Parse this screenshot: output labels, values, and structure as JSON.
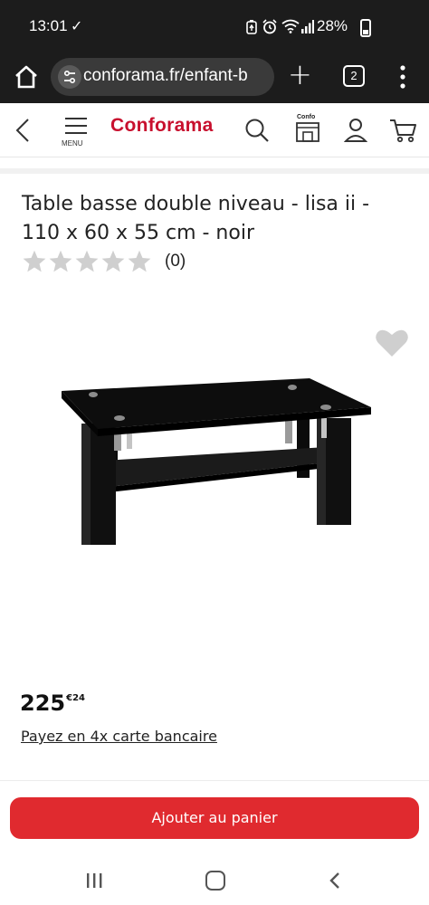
{
  "status_bar": {
    "time": "13:01",
    "battery": "28%",
    "icons": [
      "download-done-icon",
      "battery-saver-icon",
      "alarm-icon",
      "wifi-icon",
      "signal-icon",
      "battery-icon"
    ]
  },
  "browser": {
    "url": "conforama.fr/enfant-b",
    "tab_count": "2",
    "icons": [
      "home-icon",
      "site-settings-icon",
      "new-tab-icon",
      "tabs-icon",
      "menu-dots-icon"
    ]
  },
  "header": {
    "menu_label": "MENU",
    "brand": "Conforama",
    "confo_label": "Confo",
    "brand_color": "#c8102e"
  },
  "product": {
    "title": "Table basse double niveau - lisa ii - 110 x 60 x 55 cm - noir",
    "stars_filled": 0,
    "stars_total": 5,
    "review_count": "(0)",
    "price_int": "225",
    "price_dec": "€24",
    "payment_link": "Payez en 4x carte bancaire"
  },
  "actions": {
    "add_to_cart": "Ajouter au panier",
    "button_color": "#e02a2f"
  }
}
